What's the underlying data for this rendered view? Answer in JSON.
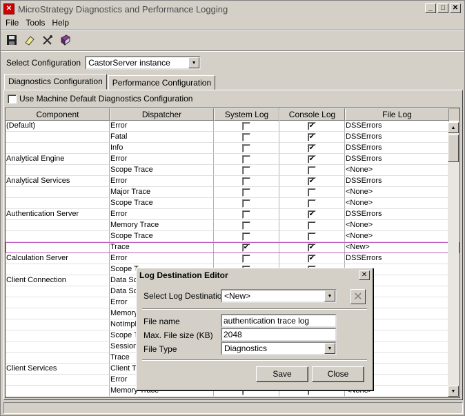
{
  "window": {
    "title": "MicroStrategy Diagnostics and Performance Logging",
    "icon": "app-icon",
    "controls": [
      "_",
      "□",
      "✕"
    ]
  },
  "menu": [
    "File",
    "Tools",
    "Help"
  ],
  "toolbar": {
    "icons": [
      "save-icon",
      "eraser-icon",
      "tools-icon",
      "help-book-icon"
    ]
  },
  "config": {
    "label": "Select Configuration",
    "value": "CastorServer instance"
  },
  "tabs": [
    "Diagnostics Configuration",
    "Performance Configuration"
  ],
  "use_default_label": "Use Machine Default Diagnostics Configuration",
  "grid": {
    "columns": [
      "Component",
      "Dispatcher",
      "System Log",
      "Console Log",
      "File Log"
    ],
    "rows": [
      {
        "component": "(Default)",
        "dispatcher": "Error",
        "system": false,
        "console": true,
        "file": "DSSErrors"
      },
      {
        "component": "",
        "dispatcher": "Fatal",
        "system": false,
        "console": true,
        "file": "DSSErrors"
      },
      {
        "component": "",
        "dispatcher": "Info",
        "system": false,
        "console": true,
        "file": "DSSErrors"
      },
      {
        "component": "Analytical Engine",
        "dispatcher": "Error",
        "system": false,
        "console": true,
        "file": "DSSErrors"
      },
      {
        "component": "",
        "dispatcher": "Scope Trace",
        "system": false,
        "console": false,
        "file": "<None>"
      },
      {
        "component": "Analytical Services",
        "dispatcher": "Error",
        "system": false,
        "console": true,
        "file": "DSSErrors"
      },
      {
        "component": "",
        "dispatcher": "Major Trace",
        "system": false,
        "console": false,
        "file": "<None>"
      },
      {
        "component": "",
        "dispatcher": "Scope Trace",
        "system": false,
        "console": false,
        "file": "<None>"
      },
      {
        "component": "Authentication Server",
        "dispatcher": "Error",
        "system": false,
        "console": true,
        "file": "DSSErrors"
      },
      {
        "component": "",
        "dispatcher": "Memory Trace",
        "system": false,
        "console": false,
        "file": "<None>"
      },
      {
        "component": "",
        "dispatcher": "Scope Trace",
        "system": false,
        "console": false,
        "file": "<None>"
      },
      {
        "component": "",
        "dispatcher": "Trace",
        "system": true,
        "console": true,
        "file": "<New>"
      },
      {
        "component": "Calculation Server",
        "dispatcher": "Error",
        "system": false,
        "console": true,
        "file": "DSSErrors"
      },
      {
        "component": "",
        "dispatcher": "Scope T",
        "system": false,
        "console": false,
        "file": ""
      },
      {
        "component": "Client Connection",
        "dispatcher": "Data Sc",
        "system": false,
        "console": false,
        "file": ""
      },
      {
        "component": "",
        "dispatcher": "Data Sc",
        "system": false,
        "console": false,
        "file": ""
      },
      {
        "component": "",
        "dispatcher": "Error",
        "system": false,
        "console": false,
        "file": "s"
      },
      {
        "component": "",
        "dispatcher": "Memory",
        "system": false,
        "console": false,
        "file": ""
      },
      {
        "component": "",
        "dispatcher": "NotImpl",
        "system": false,
        "console": false,
        "file": ""
      },
      {
        "component": "",
        "dispatcher": "Scope T",
        "system": false,
        "console": false,
        "file": ""
      },
      {
        "component": "",
        "dispatcher": "Session",
        "system": false,
        "console": false,
        "file": ""
      },
      {
        "component": "",
        "dispatcher": "Trace",
        "system": false,
        "console": false,
        "file": ""
      },
      {
        "component": "Client Services",
        "dispatcher": "Client T",
        "system": false,
        "console": false,
        "file": ""
      },
      {
        "component": "",
        "dispatcher": "Error",
        "system": false,
        "console": false,
        "file": "s"
      },
      {
        "component": "",
        "dispatcher": "Memory Trace",
        "system": false,
        "console": false,
        "file": "<None>"
      }
    ]
  },
  "dialog": {
    "title": "Log Destination Editor",
    "select_label": "Select Log Destination",
    "select_value": "<New>",
    "file_name_label": "File name",
    "file_name_value": "authentication trace log",
    "max_size_label": "Max. File size (KB)",
    "max_size_value": "2048",
    "file_type_label": "File Type",
    "file_type_value": "Diagnostics",
    "save_label": "Save",
    "close_label": "Close"
  }
}
